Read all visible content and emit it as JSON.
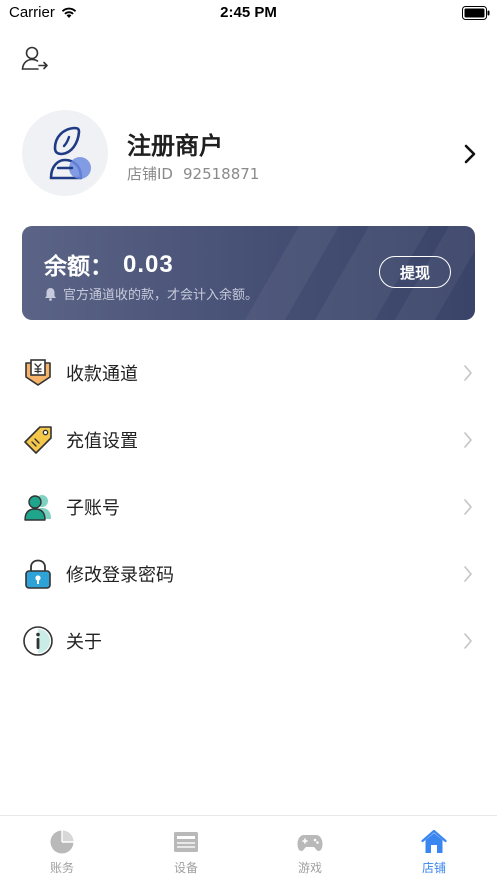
{
  "status_bar": {
    "carrier": "Carrier",
    "time": "2:45 PM"
  },
  "profile": {
    "name": "注册商户",
    "store_id_label": "店铺ID",
    "store_id": "92518871"
  },
  "balance": {
    "label": "余额：",
    "value": "0.03",
    "note": "官方通道收的款，才会计入余额。",
    "withdraw_label": "提现"
  },
  "menu": [
    {
      "label": "收款通道",
      "icon": "payment-channel-icon"
    },
    {
      "label": "充值设置",
      "icon": "recharge-tag-icon"
    },
    {
      "label": "子账号",
      "icon": "sub-account-icon"
    },
    {
      "label": "修改登录密码",
      "icon": "lock-icon"
    },
    {
      "label": "关于",
      "icon": "info-icon"
    }
  ],
  "tabs": [
    {
      "label": "账务",
      "icon": "pie-chart-icon",
      "active": false
    },
    {
      "label": "设备",
      "icon": "device-icon",
      "active": false
    },
    {
      "label": "游戏",
      "icon": "gamepad-icon",
      "active": false
    },
    {
      "label": "店铺",
      "icon": "home-icon",
      "active": true
    }
  ],
  "colors": {
    "active_tab": "#3a86f0",
    "card_start": "#5b6486",
    "card_end": "#3a4468"
  }
}
